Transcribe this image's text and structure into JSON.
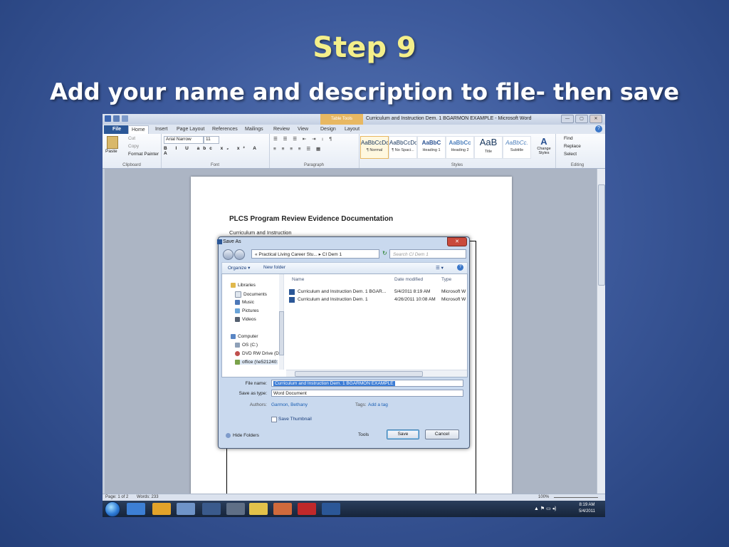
{
  "slide": {
    "title": "Step 9",
    "subtitle": "Add your name and description to file- then save"
  },
  "word": {
    "window_title": "Curriculum and Instruction Dem. 1 BGARMON EXAMPLE - Microsoft Word",
    "table_tools_label": "Table Tools",
    "tabs": [
      "File",
      "Home",
      "Insert",
      "Page Layout",
      "References",
      "Mailings",
      "Review",
      "View",
      "Design",
      "Layout"
    ],
    "ribbon": {
      "clipboard": {
        "paste": "Paste",
        "cut": "Cut",
        "copy": "Copy",
        "format_painter": "Format Painter",
        "label": "Clipboard"
      },
      "font": {
        "name": "Arial Narrow",
        "size": "11",
        "label": "Font"
      },
      "paragraph": {
        "label": "Paragraph"
      },
      "styles": {
        "label": "Styles",
        "items": [
          {
            "sample": "AaBbCcDc",
            "name": "¶ Normal"
          },
          {
            "sample": "AaBbCcDc",
            "name": "¶ No Spaci..."
          },
          {
            "sample": "AaBbC",
            "name": "Heading 1"
          },
          {
            "sample": "AaBbCc",
            "name": "Heading 2"
          },
          {
            "sample": "AaB",
            "name": "Title"
          },
          {
            "sample": "AaBbCc.",
            "name": "Subtitle"
          }
        ],
        "change_styles": "Change Styles"
      },
      "editing": {
        "find": "Find",
        "replace": "Replace",
        "select": "Select",
        "label": "Editing"
      }
    },
    "document": {
      "heading": "PLCS Program Review Evidence Documentation",
      "subheading": "Curriculum and Instruction"
    },
    "status": {
      "page": "Page: 1 of 2",
      "words": "Words: 233",
      "zoom": "100%"
    }
  },
  "dialog": {
    "title": "Save As",
    "close": "✕",
    "address": "«  Practical Living Career Stu...  ▸  CI Dem 1",
    "search_placeholder": "Search CI Dem 1",
    "organize": "Organize ▾",
    "new_folder": "New folder",
    "nav": [
      {
        "label": "Libraries",
        "icon": "libraries-icon",
        "sub": false
      },
      {
        "label": "Documents",
        "icon": "documents-icon",
        "sub": true
      },
      {
        "label": "Music",
        "icon": "music-icon",
        "sub": true
      },
      {
        "label": "Pictures",
        "icon": "pictures-icon",
        "sub": true
      },
      {
        "label": "Videos",
        "icon": "videos-icon",
        "sub": true
      },
      {
        "label": "Computer",
        "icon": "computer-icon",
        "sub": false
      },
      {
        "label": "OS (C:)",
        "icon": "drive-icon",
        "sub": true
      },
      {
        "label": "DVD RW Drive (D:",
        "icon": "dvd-drive-icon",
        "sub": true
      },
      {
        "label": "office (\\\\e521240:",
        "icon": "network-drive-icon",
        "sub": true
      }
    ],
    "columns": [
      "Name",
      "Date modified",
      "Type"
    ],
    "files": [
      {
        "name": "Curriculum and Instruction Dem. 1 BGAR...",
        "date": "5/4/2011 8:19 AM",
        "type": "Microsoft W"
      },
      {
        "name": "Curriculum and Instruction Dem. 1",
        "date": "4/26/2011 10:08 AM",
        "type": "Microsoft W"
      }
    ],
    "file_name_label": "File name:",
    "file_name_value": "Curriculum and Instruction Dem. 1 BGARMON EXAMPLE",
    "save_type_label": "Save as type:",
    "save_type_value": "Word Document",
    "authors_label": "Authors:",
    "authors_value": "Garmon, Bethany",
    "tags_label": "Tags:",
    "tags_value": "Add a tag",
    "thumbnail_label": "Save Thumbnail",
    "hide_folders": "Hide Folders",
    "tools": "Tools",
    "save": "Save",
    "cancel": "Cancel"
  },
  "taskbar": {
    "time": "8:19 AM",
    "date": "5/4/2011"
  },
  "colors": {
    "title_yellow": "#f4ef8a",
    "ribbon_file_blue": "#2b5797",
    "selection_blue": "#3a7bd5"
  }
}
